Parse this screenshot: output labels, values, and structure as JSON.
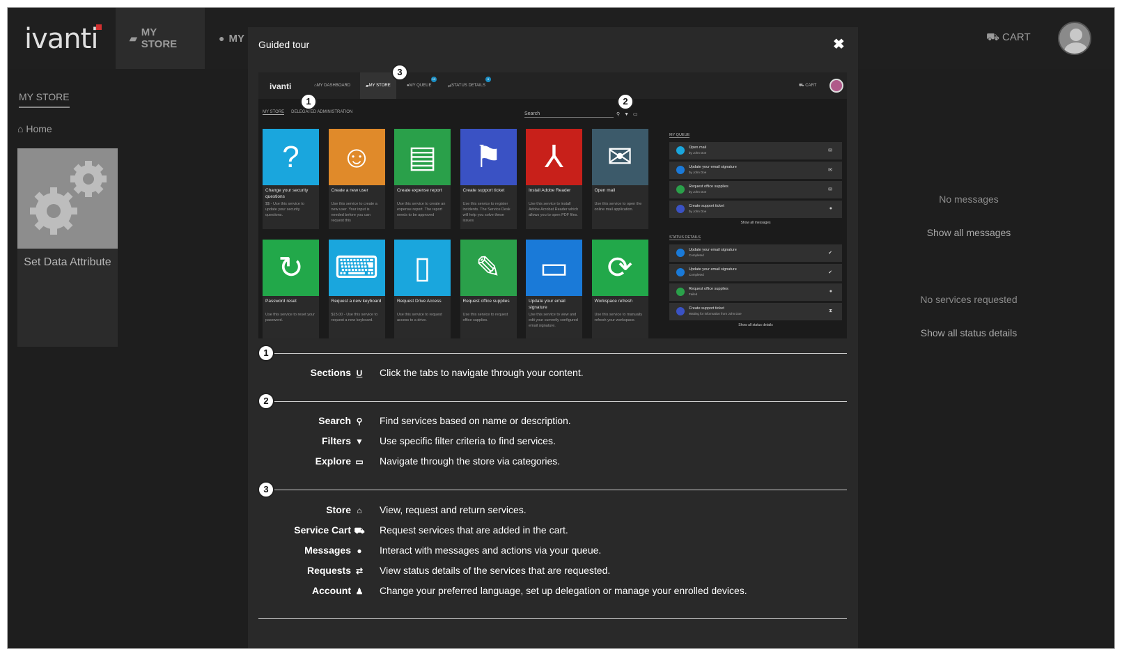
{
  "app": {
    "logo": "ivanti",
    "nav": [
      {
        "label": "MY STORE",
        "icon": "bag-icon"
      },
      {
        "label": "MY",
        "icon": "chat-icon"
      }
    ],
    "cart_label": "CART"
  },
  "sidebar": {
    "title": "MY STORE",
    "home": "Home",
    "tile_label": "Set Data Attribute"
  },
  "right_panel": {
    "no_messages": "No messages",
    "show_all_messages": "Show all messages",
    "no_services": "No services requested",
    "show_all_status": "Show all status details"
  },
  "modal": {
    "title": "Guided tour",
    "close_glyph": "✖",
    "screenshot": {
      "logo": "ivanti",
      "nav": [
        "MY DASHBOARD",
        "MY STORE",
        "MY QUEUE",
        "STATUS DETAILS"
      ],
      "queue_badge": "13",
      "status_badge": "8",
      "cart": "CART",
      "tabs": [
        "MY STORE",
        "DELEGATED ADMINISTRATION"
      ],
      "search": "Search",
      "tiles_row1": [
        {
          "name": "Change your security questions",
          "desc": "$$ - Use this service to update your security questions.",
          "color": "#1aa6dd",
          "glyph": "?"
        },
        {
          "name": "Create a new user",
          "desc": "Use this service to create a new user. Your input is needed before you can request this",
          "color": "#e08a2a",
          "glyph": "☺"
        },
        {
          "name": "Create expense report",
          "desc": "Use this service to create an expense report. The report needs to be approved",
          "color": "#2aa04a",
          "glyph": "▤"
        },
        {
          "name": "Create support ticket",
          "desc": "Use this service to register incidents. The Service Desk will help you solve these issues",
          "color": "#3a52c4",
          "glyph": "⚑"
        },
        {
          "name": "Install Adobe Reader",
          "desc": "Use this service to install Adobe Acrobat Reader which allows you to open PDF files.",
          "color": "#c8201a",
          "glyph": "⅄"
        },
        {
          "name": "Open mail",
          "desc": "Use this service to open the online mail application.",
          "color": "#3c5a6a",
          "glyph": "✉"
        }
      ],
      "tiles_row2": [
        {
          "name": "Password reset",
          "desc": "Use this service to reset your password.",
          "color": "#22a84a",
          "glyph": "↻"
        },
        {
          "name": "Request a new keyboard",
          "desc": "$15.00 - Use this service to request a new keyboard.",
          "color": "#1aa6dd",
          "glyph": "⌨"
        },
        {
          "name": "Request Drive Access",
          "desc": "Use this service to request access to a drive.",
          "color": "#1aa6dd",
          "glyph": "▯"
        },
        {
          "name": "Request office supplies",
          "desc": "Use this service to request office supplies.",
          "color": "#2aa04a",
          "glyph": "✎"
        },
        {
          "name": "Update your email signature",
          "desc": "Use this service to view and edit your currently configured email signature.",
          "color": "#1a7ad8",
          "glyph": "▭"
        },
        {
          "name": "Workspace refresh",
          "desc": "Use this service to manually refresh your workspace.",
          "color": "#22a84a",
          "glyph": "⟳"
        }
      ],
      "queue_title": "MY QUEUE",
      "queue": [
        {
          "title": "Open mail",
          "sub": "by John Doe",
          "color": "#1aa6dd",
          "action": "✉"
        },
        {
          "title": "Update your email signature",
          "sub": "by John Doe",
          "color": "#1a7ad8",
          "action": "✉"
        },
        {
          "title": "Request office supplies",
          "sub": "by John Doe",
          "color": "#2aa04a",
          "action": "✉"
        },
        {
          "title": "Create support ticket",
          "sub": "by John Doe",
          "color": "#3a52c4",
          "action": "●"
        }
      ],
      "show_all_messages": "Show all messages",
      "status_title": "STATUS DETAILS",
      "status": [
        {
          "title": "Update your email signature",
          "sub": "Completed",
          "color": "#1a7ad8",
          "action": "✔"
        },
        {
          "title": "Update your email signature",
          "sub": "Completed",
          "color": "#1a7ad8",
          "action": "✔"
        },
        {
          "title": "Request office supplies",
          "sub": "Failed",
          "color": "#2aa04a",
          "action": "●"
        },
        {
          "title": "Create support ticket",
          "sub": "Waiting for information from John Doe",
          "color": "#3a52c4",
          "action": "⧗"
        }
      ],
      "show_all_status": "Show all status details",
      "callouts": [
        "1",
        "2",
        "3"
      ]
    },
    "sections": [
      {
        "number": "1",
        "items": [
          {
            "label": "Sections",
            "icon": "U",
            "icon_name": "underline-icon",
            "desc": "Click the tabs to navigate through your content."
          }
        ]
      },
      {
        "number": "2",
        "items": [
          {
            "label": "Search",
            "icon": "🔍︎",
            "icon_name": "search-icon",
            "desc": "Find services based on name or description."
          },
          {
            "label": "Filters",
            "icon": "▼",
            "icon_name": "filter-icon",
            "desc": "Use specific filter criteria to find services."
          },
          {
            "label": "Explore",
            "icon": "🗀",
            "icon_name": "folder-icon",
            "desc": "Navigate through the store via categories."
          }
        ]
      },
      {
        "number": "3",
        "items": [
          {
            "label": "Store",
            "icon": "⌂",
            "icon_name": "home-icon",
            "desc": "View, request and return services."
          },
          {
            "label": "Service Cart",
            "icon": "⛟",
            "icon_name": "cart-icon",
            "desc": "Request services that are added in the cart."
          },
          {
            "label": "Messages",
            "icon": "●",
            "icon_name": "comment-icon",
            "desc": "Interact with messages and actions via your queue."
          },
          {
            "label": "Requests",
            "icon": "⇄",
            "icon_name": "exchange-icon",
            "desc": "View status details of the services that are requested."
          },
          {
            "label": "Account",
            "icon": "♟",
            "icon_name": "user-icon",
            "desc": "Change your preferred language, set up delegation or manage your enrolled devices."
          }
        ]
      }
    ]
  }
}
